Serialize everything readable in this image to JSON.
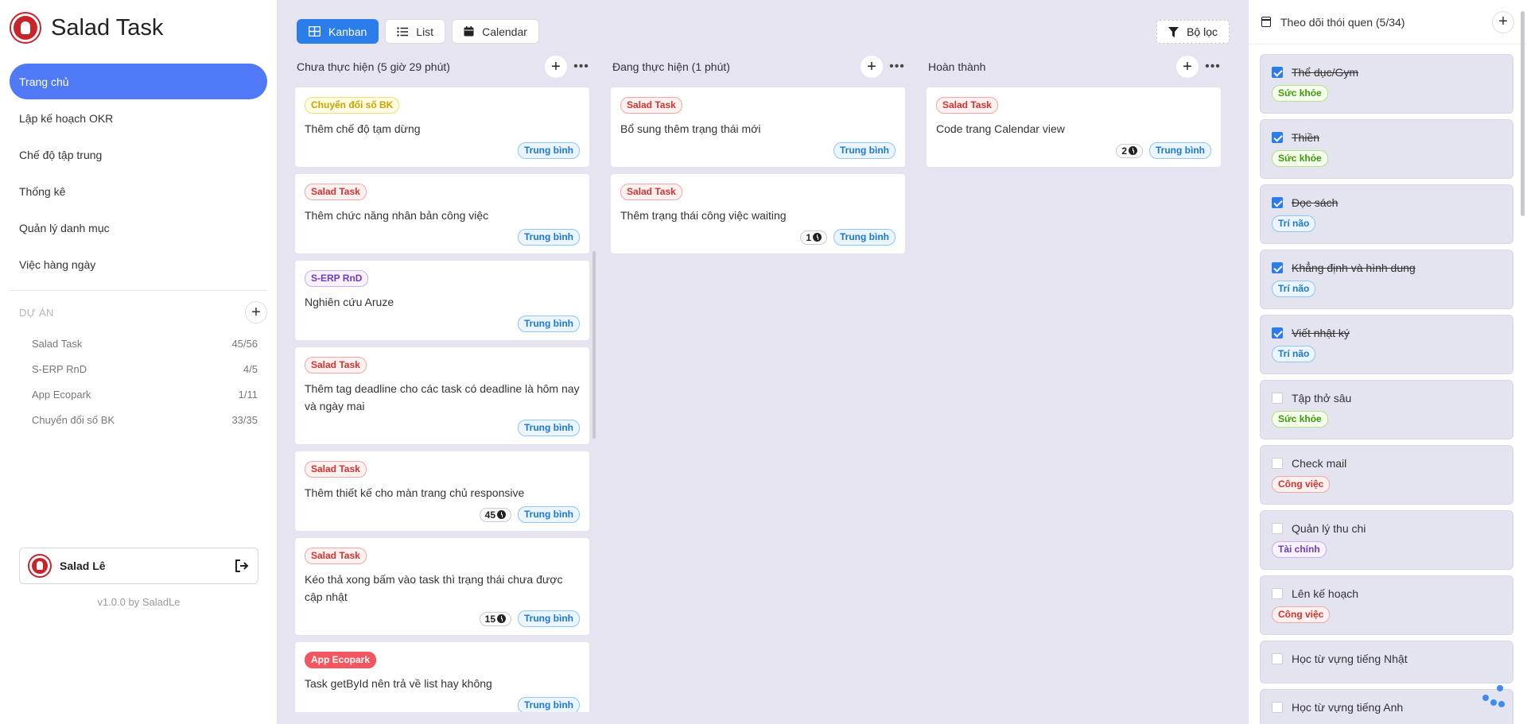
{
  "app": {
    "name": "Salad Task",
    "version": "v1.0.0 by SaladLe"
  },
  "nav": [
    {
      "label": "Trang chủ",
      "active": true
    },
    {
      "label": "Lập kế hoạch OKR"
    },
    {
      "label": "Chế độ tập trung"
    },
    {
      "label": "Thống kê"
    },
    {
      "label": "Quản lý danh mục"
    },
    {
      "label": "Việc hàng ngày"
    }
  ],
  "projects": {
    "title": "DỰ ÁN",
    "items": [
      {
        "name": "Salad Task",
        "count": "45/56"
      },
      {
        "name": "S-ERP RnD",
        "count": "4/5"
      },
      {
        "name": "App Ecopark",
        "count": "1/11"
      },
      {
        "name": "Chuyển đổi số BK",
        "count": "33/35"
      }
    ]
  },
  "user": {
    "name": "Salad Lê"
  },
  "toolbar": {
    "kanban": "Kanban",
    "list": "List",
    "calendar": "Calendar",
    "filter": "Bộ lọc"
  },
  "columns": [
    {
      "title": "Chưa thực hiện (5 giờ 29 phút)",
      "cards": [
        {
          "tag": "Chuyển đổi số BK",
          "title": "Thêm chế độ tạm dừng",
          "priority": "Trung bình"
        },
        {
          "tag": "Salad Task",
          "title": "Thêm chức năng nhân bản công việc",
          "priority": "Trung bình"
        },
        {
          "tag": "S-ERP RnD",
          "title": "Nghiên cứu Aruze",
          "priority": "Trung bình"
        },
        {
          "tag": "Salad Task",
          "title": "Thêm tag deadline cho các task có deadline là hôm nay và ngày mai",
          "priority": "Trung bình"
        },
        {
          "tag": "Salad Task",
          "title": "Thêm thiết kế cho màn trang chủ responsive",
          "count": "45",
          "priority": "Trung bình"
        },
        {
          "tag": "Salad Task",
          "title": "Kéo thả xong bấm vào task thì trạng thái chưa được cập nhật",
          "count": "15",
          "priority": "Trung bình"
        },
        {
          "tag": "App Ecopark",
          "title": "Task getById nên trả về list hay không",
          "priority": "Trung bình"
        }
      ]
    },
    {
      "title": "Đang thực hiện (1 phút)",
      "cards": [
        {
          "tag": "Salad Task",
          "title": "Bổ sung thêm trạng thái mới",
          "priority": "Trung bình"
        },
        {
          "tag": "Salad Task",
          "title": "Thêm trạng thái công việc waiting",
          "count": "1",
          "priority": "Trung bình"
        }
      ]
    },
    {
      "title": "Hoàn thành",
      "cards": [
        {
          "tag": "Salad Task",
          "title": "Code trang Calendar view",
          "count": "2",
          "priority": "Trung bình"
        }
      ]
    }
  ],
  "habits": {
    "title": "Theo dõi thói quen (5/34)",
    "items": [
      {
        "name": "Thể dục/Gym",
        "tag": "Sức khỏe",
        "done": true
      },
      {
        "name": "Thiền",
        "tag": "Sức khỏe",
        "done": true
      },
      {
        "name": "Đọc sách",
        "tag": "Trí não",
        "done": true
      },
      {
        "name": "Khẳng định và hình dung",
        "tag": "Trí não",
        "done": true
      },
      {
        "name": "Viết nhật ký",
        "tag": "Trí não",
        "done": true
      },
      {
        "name": "Tập thở sâu",
        "tag": "Sức khỏe",
        "done": false
      },
      {
        "name": "Check mail",
        "tag": "Công việc",
        "done": false
      },
      {
        "name": "Quản lý thu chi",
        "tag": "Tài chính",
        "done": false
      },
      {
        "name": "Lên kế hoạch",
        "tag": "Công việc",
        "done": false
      },
      {
        "name": "Học từ vựng tiếng Nhật",
        "tag": "",
        "done": false
      },
      {
        "name": "Học từ vựng tiếng Anh",
        "tag": "",
        "done": false
      }
    ]
  }
}
